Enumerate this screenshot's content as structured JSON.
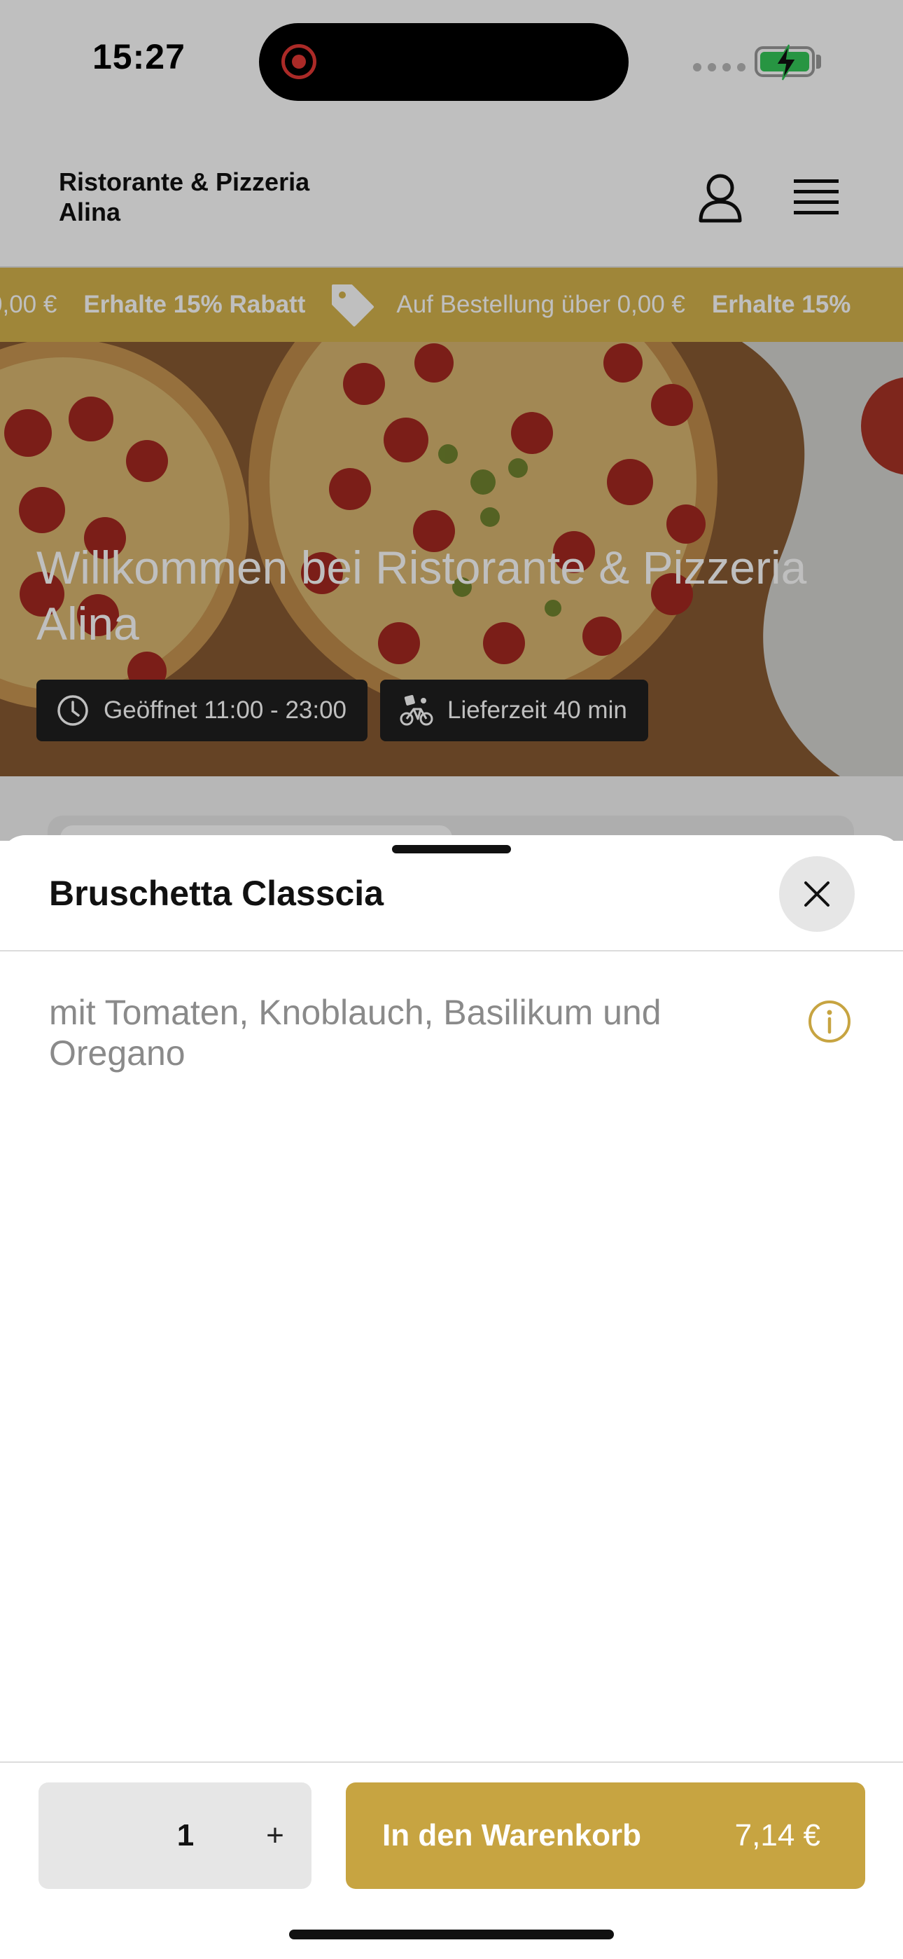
{
  "status_bar": {
    "time": "15:27"
  },
  "header": {
    "brand": "Ristorante & Pizzeria Alina"
  },
  "promo": {
    "items": [
      {
        "text": "0,00 €",
        "bold": false
      },
      {
        "text": "Erhalte 15% Rabatt",
        "bold": true
      },
      {
        "text": "Auf Bestellung über 0,00 €",
        "bold": false
      },
      {
        "text": "Erhalte 15%",
        "bold": true
      }
    ]
  },
  "hero": {
    "title": "Willkommen bei Ristorante & Pizzeria Alina",
    "opening_hours": "Geöffnet 11:00 - 23:00",
    "delivery_time": "Lieferzeit 40 min"
  },
  "sheet": {
    "title": "Bruschetta Classcia",
    "description": "mit Tomaten, Knoblauch, Basilikum und Oregano",
    "quantity": "1",
    "plus_label": "+",
    "cart_label": "In den Warenkorb",
    "price": "7,14 €"
  },
  "colors": {
    "accent": "#c7a441",
    "promo_bar": "#d4b34c",
    "chip_bg": "#1f1f1f",
    "battery": "#34c759",
    "recording": "#e53935"
  },
  "icons": [
    "recording-icon",
    "battery-icon",
    "user-icon",
    "menu-icon",
    "tag-icon",
    "clock-icon",
    "bicycle-icon",
    "close-icon",
    "info-icon"
  ]
}
